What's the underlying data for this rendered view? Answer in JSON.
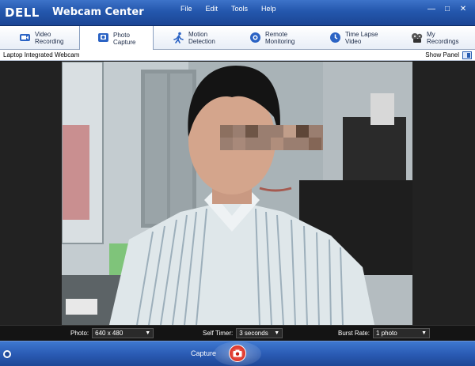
{
  "app": {
    "brand": "DELL",
    "title": "Webcam Center"
  },
  "menu": [
    "File",
    "Edit",
    "Tools",
    "Help"
  ],
  "window_controls": {
    "minimize": "—",
    "maximize": "□",
    "close": "✕"
  },
  "tabs": [
    {
      "label": "Video\nRecording",
      "icon": "video-camera-icon"
    },
    {
      "label": "Photo\nCapture",
      "icon": "camera-icon",
      "active": true
    },
    {
      "label": "Motion\nDetection",
      "icon": "running-figure-icon"
    },
    {
      "label": "Remote\nMonitoring",
      "icon": "remote-monitor-icon"
    },
    {
      "label": "Time Lapse\nVideo",
      "icon": "clock-icon"
    },
    {
      "label": "My\nRecordings",
      "icon": "film-reel-icon"
    }
  ],
  "subheader": {
    "camera": "Laptop Integrated Webcam",
    "show_panel": "Show Panel"
  },
  "controls": {
    "photo_label": "Photo:",
    "photo_value": "640 x 480",
    "timer_label": "Self Timer:",
    "timer_value": "3 seconds",
    "burst_label": "Burst Rate:",
    "burst_value": "1 photo"
  },
  "bottom": {
    "capture_label": "Capture"
  },
  "colors": {
    "titlebar": "#2457ad",
    "accent_red": "#c81e14"
  }
}
